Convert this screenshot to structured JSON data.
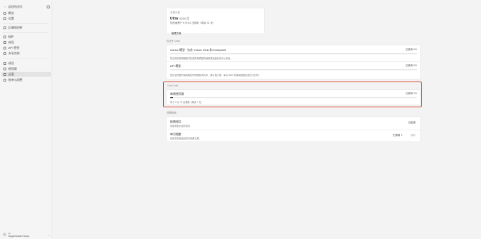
{
  "sidebar": {
    "back_label": "返回到应用",
    "items": [
      {
        "label": "概览"
      },
      {
        "label": "设置"
      },
      {
        "label": "后端和机密"
      },
      {
        "label": "插件"
      },
      {
        "label": "成员"
      },
      {
        "label": "API 密钥"
      },
      {
        "label": "共享实例"
      },
      {
        "label": "成员"
      },
      {
        "label": "使用量"
      },
      {
        "label": "运营"
      },
      {
        "label": "账单与消费"
      }
    ],
    "user": {
      "line1": "ct",
      "line2": "SugarSnack  Heavy"
    }
  },
  "plan": {
    "label": "当前计划",
    "name": "Ultra",
    "price": "$200/月",
    "renew": "您的套餐于 5 月 16 日更新（剩余 31 天）",
    "manage_label": "管理方案"
  },
  "usage": {
    "section_label": "包含于 Ultra",
    "rows": [
      {
        "title": "Cursor 模型 · 包含 Cursor Grok 和 Composer",
        "pct_text": "已使用 0%",
        "pct": 0,
        "desc": "您当前的使用额度可包含所有模型的使用量及超出的代价费用。"
      },
      {
        "title": "API 模型",
        "pct_text": "已使用 0%",
        "pct": 0,
        "desc": "您包含的额外使用量在所有模型间共享，按价值计算；每月 $400 的使用额度包含在计划内。"
      }
    ]
  },
  "quick": {
    "section_label": "Grok Fast",
    "title": "每周使用量",
    "pct_text": "已使用 1%",
    "pct": 1,
    "desc": "将于 5 月 21 日重置（剩余 7 天）"
  },
  "settings": {
    "section_label": "按需使用",
    "rows": [
      {
        "title": "按需使用",
        "desc": "设置按需计费的状态",
        "action": "已启用"
      },
      {
        "title": "每月限额",
        "desc": "设置您在各地区的月消费上限。",
        "select": "已使用 ▾",
        "save": "保存"
      }
    ]
  }
}
